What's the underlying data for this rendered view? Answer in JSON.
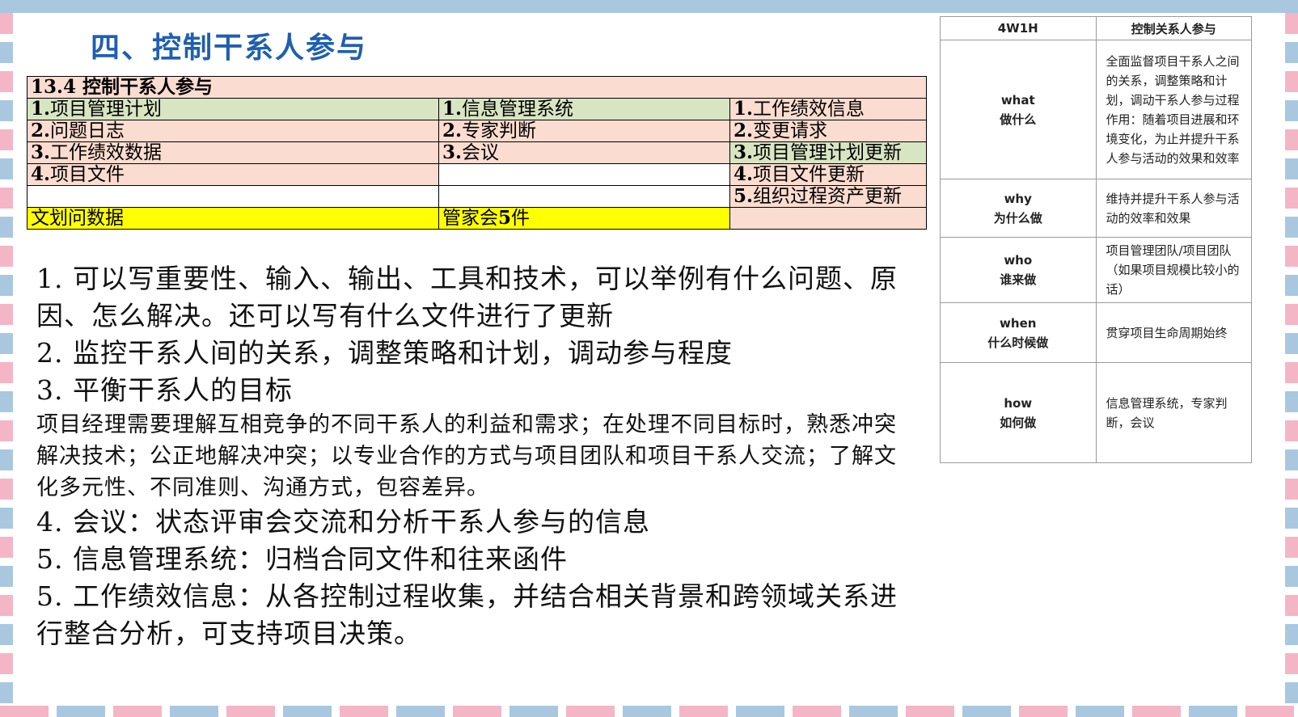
{
  "title": "四、控制干系人参与",
  "itto": {
    "header": "13.4 控制干系人参与",
    "rows": [
      {
        "c1_num": "1.",
        "c1": "项目管理计划",
        "c2_num": "1.",
        "c2": "信息管理系统",
        "c3_num": "1.",
        "c3": "工作绩效信息"
      },
      {
        "c1_num": "2.",
        "c1": "问题日志",
        "c2_num": "2.",
        "c2": "专家判断",
        "c3_num": "2.",
        "c3": "变更请求"
      },
      {
        "c1_num": "3.",
        "c1": "工作绩效数据",
        "c2_num": "3.",
        "c2": "会议",
        "c3_num": "3.",
        "c3": "项目管理计划更新"
      },
      {
        "c1_num": "4.",
        "c1": "项目文件",
        "c2_num": "",
        "c2": "",
        "c3_num": "4.",
        "c3": "项目文件更新"
      },
      {
        "c1_num": "",
        "c1": "",
        "c2_num": "",
        "c2": "",
        "c3_num": "5.",
        "c3": "组织过程资产更新"
      }
    ],
    "mnemonic_1": "文划问数据",
    "mnemonic_2_pre": "管家会",
    "mnemonic_2_num": "5",
    "mnemonic_2_post": "件"
  },
  "notes": {
    "p1": "1. 可以写重要性、输入、输出、工具和技术，可以举例有什么问题、原因、怎么解决。还可以写有什么文件进行了更新",
    "p2": "2. 监控干系人间的关系，调整策略和计划，调动参与程度",
    "p3": "3. 平衡干系人的目标",
    "p3_detail": "项目经理需要理解互相竞争的不同干系人的利益和需求；在处理不同目标时，熟悉冲突解决技术；公正地解决冲突；以专业合作的方式与项目团队和项目干系人交流；了解文化多元性、不同准则、沟通方式，包容差异。",
    "p4": "4. 会议：状态评审会交流和分析干系人参与的信息",
    "p5": "5. 信息管理系统：归档合同文件和往来函件",
    "p6": "5. 工作绩效信息：从各控制过程收集，并结合相关背景和跨领域关系进行整合分析，可支持项目决策。"
  },
  "w1h": {
    "head_key": "4W1H",
    "head_val": "控制关系人参与",
    "rows": [
      {
        "k_en": "what",
        "k_cn": "做什么",
        "v": "全面监督项目干系人之间的关系，调整策略和计划，调动干系人参与过程作用：随着项目进展和环境变化，为止并提升干系人参与活动的效果和效率"
      },
      {
        "k_en": "why",
        "k_cn": "为什么做",
        "v": "维持并提升干系人参与活动的效率和效果"
      },
      {
        "k_en": "who",
        "k_cn": "谁来做",
        "v": "项目管理团队/项目团队（如果项目规模比较小的话）"
      },
      {
        "k_en": "when",
        "k_cn": "什么时候做",
        "v": "贯穿项目生命周期始终"
      },
      {
        "k_en": "how",
        "k_cn": "如何做",
        "v": "信息管理系统，专家判断，会议"
      }
    ]
  }
}
